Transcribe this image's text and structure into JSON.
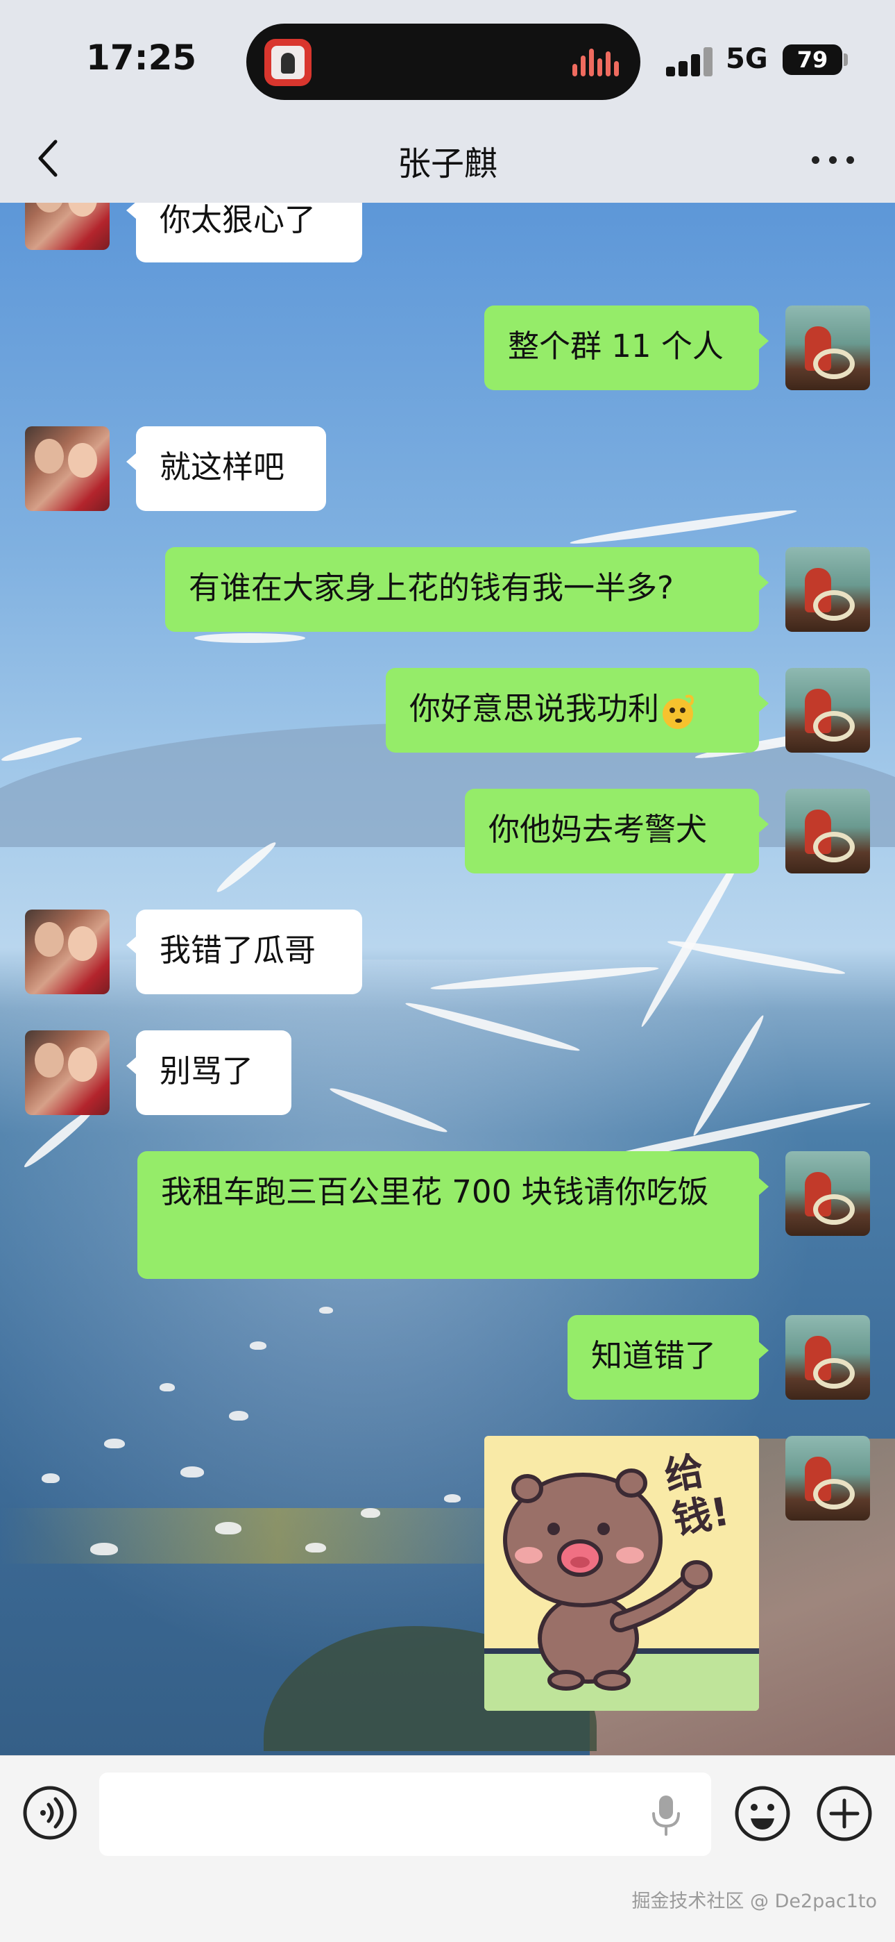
{
  "status_bar": {
    "time": "17:25",
    "network": "5G",
    "battery": "79"
  },
  "header": {
    "title": "张子麒"
  },
  "messages": [
    {
      "from": "contact",
      "text": "你太狠心了"
    },
    {
      "from": "me",
      "text": "整个群 11 个人"
    },
    {
      "from": "contact",
      "text": "就这样吧"
    },
    {
      "from": "me",
      "text": "有谁在大家身上花的钱有我一半多?"
    },
    {
      "from": "me",
      "text": "你好意思说我功利",
      "emoji": "thinking-face-icon"
    },
    {
      "from": "me",
      "text": "你他妈去考警犬"
    },
    {
      "from": "contact",
      "text": "我错了瓜哥"
    },
    {
      "from": "contact",
      "text": "别骂了"
    },
    {
      "from": "me",
      "text": "我租车跑三百公里花 700 块钱请你吃饭"
    },
    {
      "from": "me",
      "text": "知道错了"
    },
    {
      "from": "me",
      "sticker": "pig-give-money-sticker",
      "sticker_text": "给钱!"
    }
  ],
  "input": {
    "value": "",
    "placeholder": ""
  },
  "icons": {
    "back": "chevron-left-icon",
    "more": "more-dots-icon",
    "voice": "voice-mode-icon",
    "mic": "microphone-icon",
    "emoji": "smiley-icon",
    "plus": "plus-icon"
  },
  "watermark": "掘金技术社区 @ De2pac1to",
  "colors": {
    "outgoing_bubble": "#95ec69",
    "incoming_bubble": "#ffffff",
    "header_bg": "#e3e6ec",
    "input_bar_bg": "#f4f4f4"
  }
}
